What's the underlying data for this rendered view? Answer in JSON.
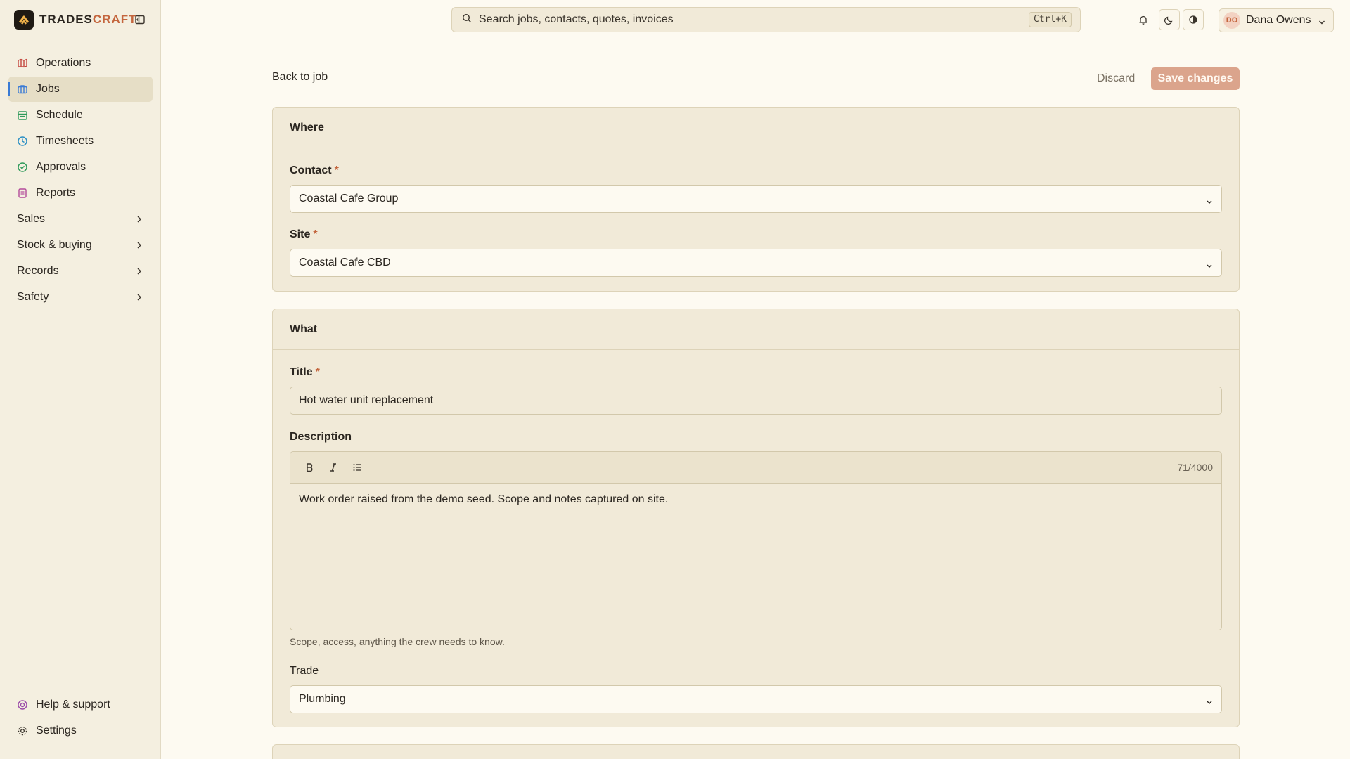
{
  "brand": {
    "name_main": "TRADES",
    "name_accent": "CRAFT"
  },
  "sidebar": {
    "items": [
      {
        "label": "Operations",
        "icon": "map-icon",
        "color": "#c4463e"
      },
      {
        "label": "Jobs",
        "icon": "briefcase-icon",
        "color": "#3a7bd5",
        "active": true
      },
      {
        "label": "Schedule",
        "icon": "calendar-icon",
        "color": "#2e9a5a"
      },
      {
        "label": "Timesheets",
        "icon": "clock-icon",
        "color": "#2b8fc4"
      },
      {
        "label": "Approvals",
        "icon": "check-circle-icon",
        "color": "#2e9a5a"
      },
      {
        "label": "Reports",
        "icon": "document-icon",
        "color": "#b34a9a"
      }
    ],
    "groups": [
      "Sales",
      "Stock & buying",
      "Records",
      "Safety"
    ],
    "footer": [
      {
        "label": "Help & support",
        "icon": "lifebuoy-icon"
      },
      {
        "label": "Settings",
        "icon": "gear-icon"
      }
    ]
  },
  "topbar": {
    "search_placeholder": "Search jobs, contacts, quotes, invoices",
    "search_shortcut": "Ctrl+K",
    "user": {
      "initials": "DO",
      "name": "Dana Owens"
    }
  },
  "page": {
    "back_label": "Back to job",
    "discard_label": "Discard",
    "save_label": "Save changes",
    "accent": "#dba48c"
  },
  "where": {
    "title": "Where",
    "contact_label": "Contact",
    "contact_value": "Coastal Cafe Group",
    "site_label": "Site",
    "site_value": "Coastal Cafe CBD",
    "required_mark": "*"
  },
  "what": {
    "title": "What",
    "title_label": "Title",
    "title_value": "Hot water unit replacement",
    "description_label": "Description",
    "description_value": "Work order raised from the demo seed. Scope and notes captured on site.",
    "char_count": "71/4000",
    "description_help": "Scope, access, anything the crew needs to know.",
    "trade_label": "Trade",
    "trade_value": "Plumbing",
    "required_mark": "*"
  }
}
